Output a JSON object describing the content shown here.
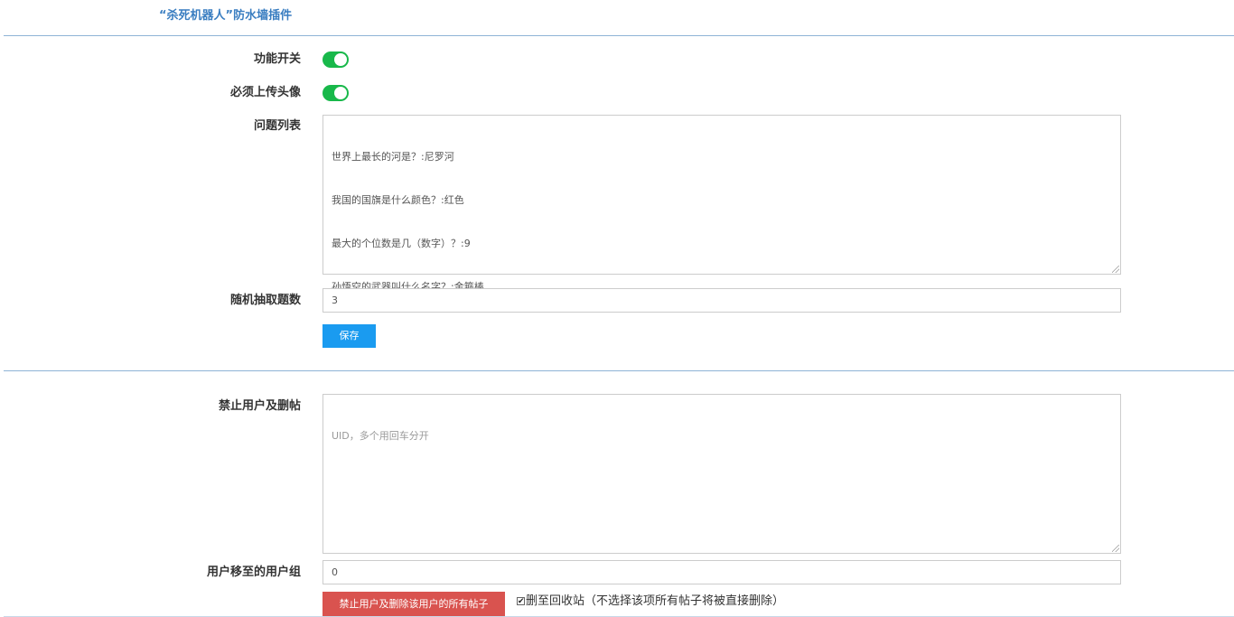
{
  "plugin_title": "“杀死机器人”防水墙插件",
  "settings": {
    "feature_switch": {
      "label": "功能开关",
      "on": true
    },
    "require_avatar": {
      "label": "必须上传头像",
      "on": true
    },
    "question_list": {
      "label": "问题列表",
      "lines": [
        "世界上最长的河是？:尼罗河",
        "我国的国旗是什么颜色？:红色",
        "最大的个位数是几（数字）？:9",
        "孙悟空的武器叫什么名字？:金箍棒"
      ]
    },
    "random_count": {
      "label": "随机抽取题数",
      "value": "3"
    },
    "save_label": "保存"
  },
  "ban": {
    "label": "禁止用户及删帖",
    "placeholder": "UID，多个用回车分开",
    "move_group": {
      "label": "用户移至的用户组",
      "value": "0"
    },
    "ban_button_label": "禁止用户及删除该用户的所有帖子",
    "recycle": {
      "checked": true,
      "label": "删至回收站（不选择该项所有帖子将被直接删除）"
    }
  },
  "colors": {
    "accent": "#3a7ec1",
    "toggle_on": "#18b84a",
    "save_button": "#1a9bf0",
    "danger_button": "#d9534f"
  }
}
